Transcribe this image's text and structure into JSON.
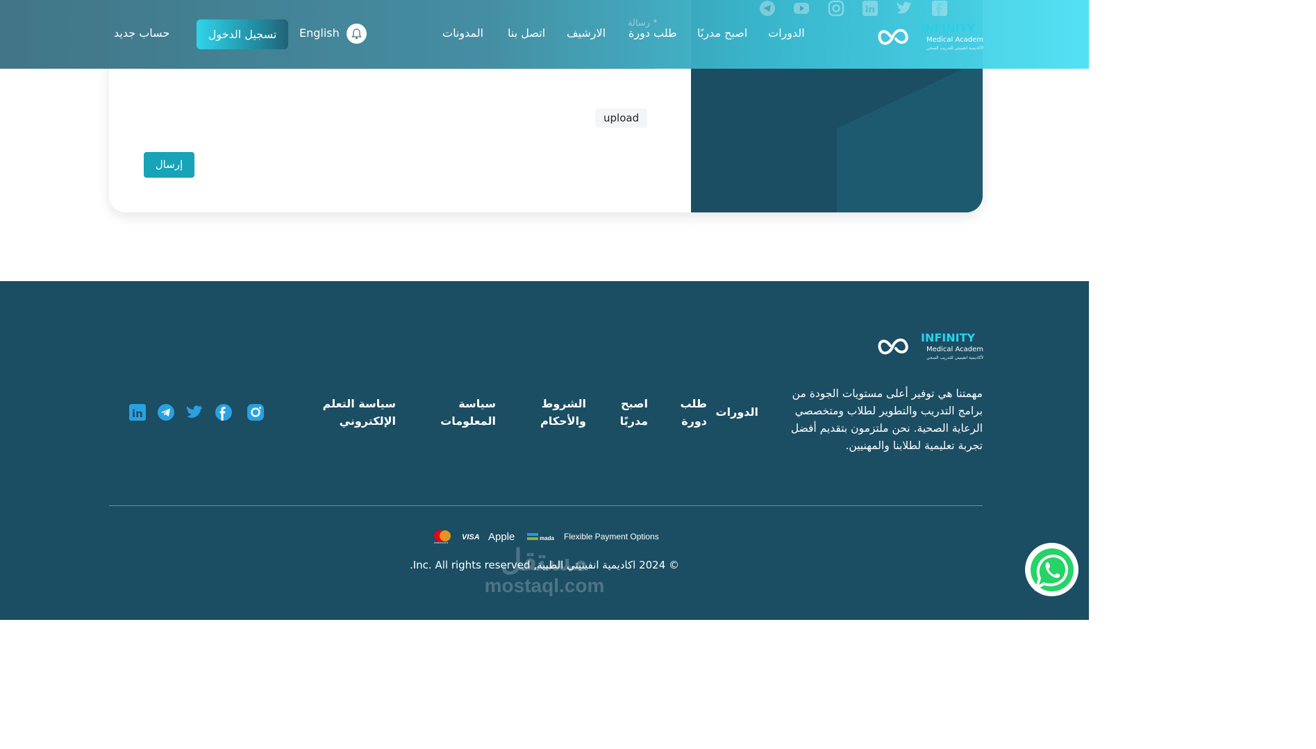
{
  "header": {
    "brand": {
      "name": "INFINITY",
      "sub": "Medical Academy",
      "tagline": "الأكاديمية انفينيتي للتدريب الصحي"
    },
    "nav": [
      "الدورات",
      "اصبح مدربًا",
      "طلب دورة",
      "الارشيف",
      "اتصل بنا",
      "المدونات"
    ],
    "nav_super": "رسالة *",
    "language": "English",
    "login_label": "تسجيل الدخول",
    "signup_label": "حساب جديد",
    "social_icons": [
      "telegram-icon",
      "youtube-icon",
      "instagram-icon",
      "linkedin-icon",
      "twitter-icon",
      "facebook-icon"
    ]
  },
  "form": {
    "upload_label": "upload",
    "send_label": "إرسال"
  },
  "footer": {
    "brand": {
      "name": "INFINITY",
      "sub": "Medical Academy",
      "tagline": "الأكاديمية انفينيتي للتدريب الصحي"
    },
    "mission": "مهمتنا هي توفير أعلى مستويات الجودة من برامج التدريب والتطوير لطلاب ومتخصصي الرعاية الصحية. نحن ملتزمون بتقديم أفضل تجربة تعليمية لطلابنا والمهنيين.",
    "links": [
      "الدورات",
      "طلب دورة",
      "اصبح مدربًا",
      "الشروط والأحكام",
      "سياسة المعلومات",
      "سياسة التعلم الإلكتروني"
    ],
    "social_icons": [
      "instagram-icon",
      "facebook-icon",
      "twitter-icon",
      "telegram-icon",
      "linkedin-icon"
    ],
    "payment_label": "Flexible Payment Options",
    "payment_methods": [
      "mada",
      "Apple Pay",
      "VISA",
      "mastercard"
    ],
    "copyright": "© 2024 اكاديمية انفينيتي الطبية, Inc. All rights reserved."
  },
  "watermark": {
    "arabic": "مستقل",
    "latin": "mostaql.com"
  },
  "colors": {
    "primary": "#1b4d63",
    "accent": "#17a3b8",
    "header_gradient_end": "#4fe0f5"
  }
}
